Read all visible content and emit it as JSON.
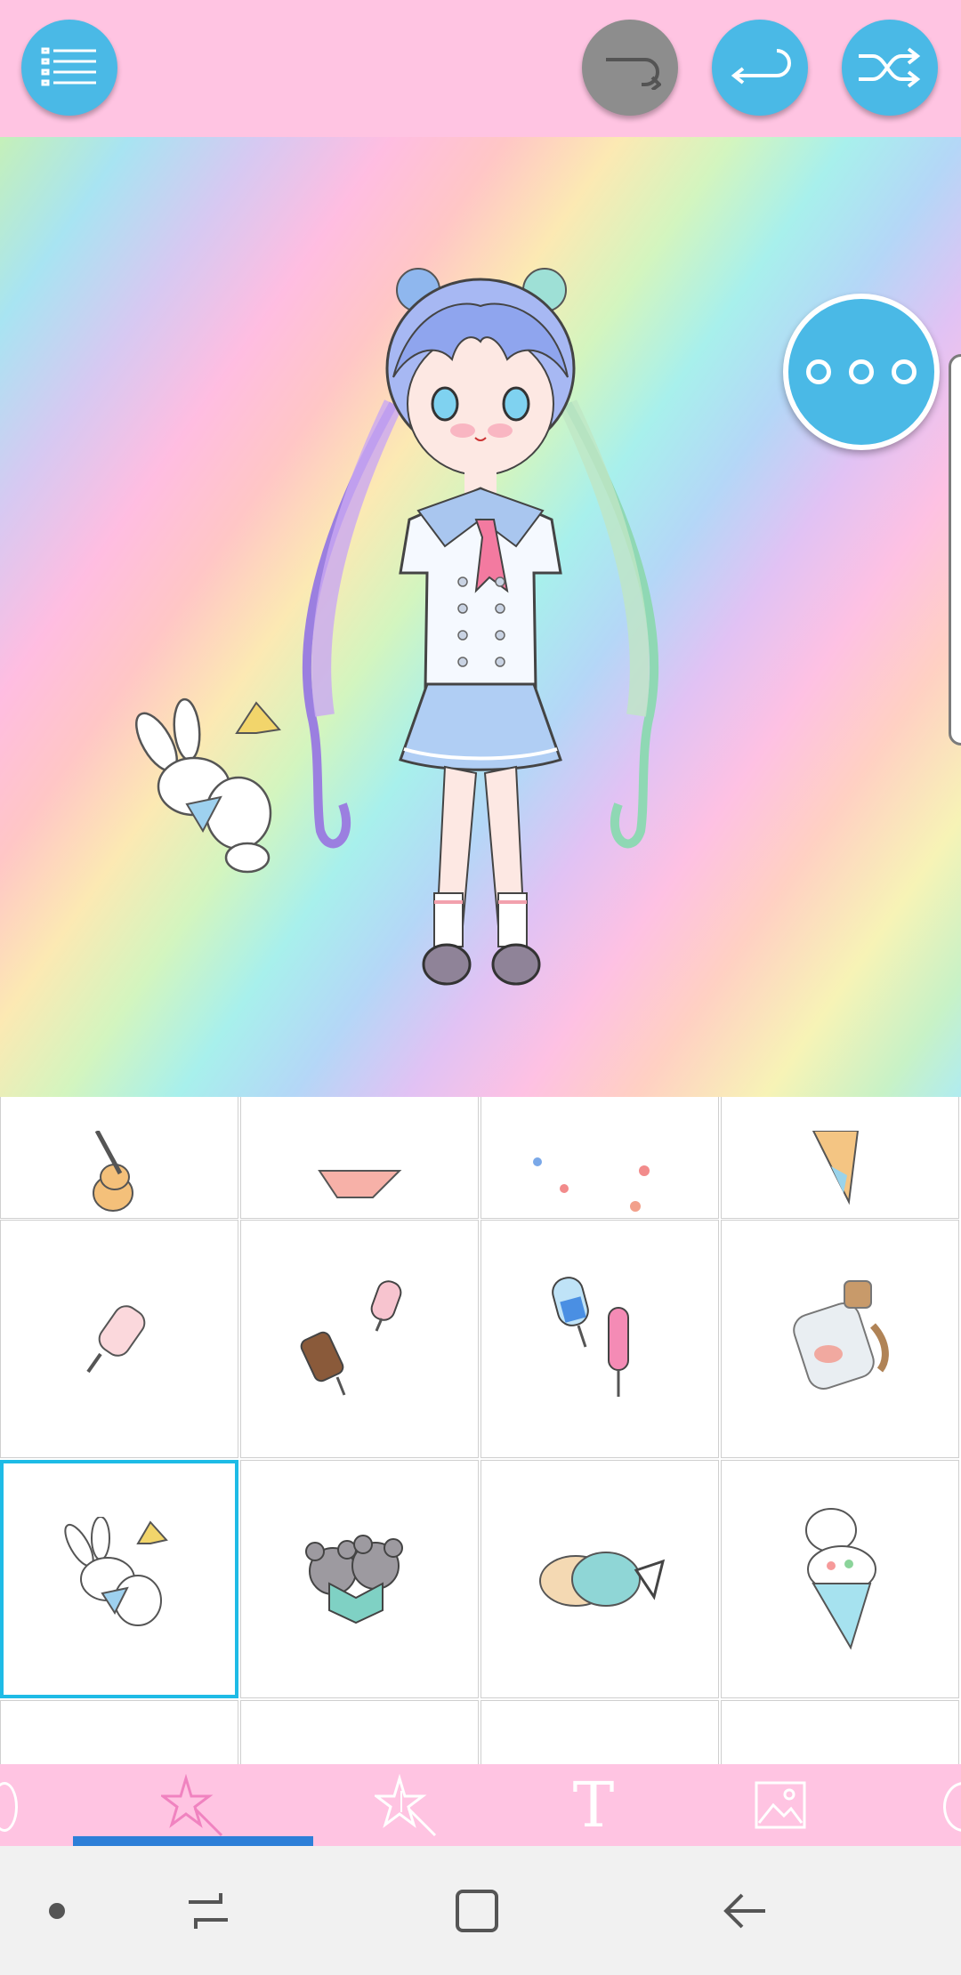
{
  "toolbar": {
    "menu": "menu-icon",
    "redo": "redo-icon",
    "undo": "undo-icon",
    "shuffle": "shuffle-icon"
  },
  "canvas": {
    "more": "more-options-icon"
  },
  "items_grid": {
    "rows": [
      [
        "guitar",
        "cake-slice",
        "sprinkles",
        "ice-cream-cone"
      ],
      [
        "popsicle",
        "chocolate-popsicles",
        "popsicle-and-lollipop",
        "shell-bottle"
      ],
      [
        "bunny-with-horn",
        "mice-reading-book",
        "penguins",
        "cat-ice-cream-cone"
      ],
      [
        "partial-item",
        "partial-item",
        "partial-item",
        "partial-item"
      ]
    ],
    "selected": "bunny-with-horn"
  },
  "tabs": [
    {
      "name": "sticker-tab",
      "icon": "star-wand-icon",
      "active": true
    },
    {
      "name": "effects-tab",
      "icon": "sparkle-star-icon",
      "active": false
    },
    {
      "name": "text-tab",
      "label": "T",
      "active": false
    },
    {
      "name": "background-tab",
      "icon": "image-icon",
      "active": false
    }
  ],
  "colors": {
    "pink": "#ffc4e2",
    "accent_blue": "#4ab9e6",
    "selection": "#1ebbe6",
    "tab_active": "#f083c0"
  }
}
